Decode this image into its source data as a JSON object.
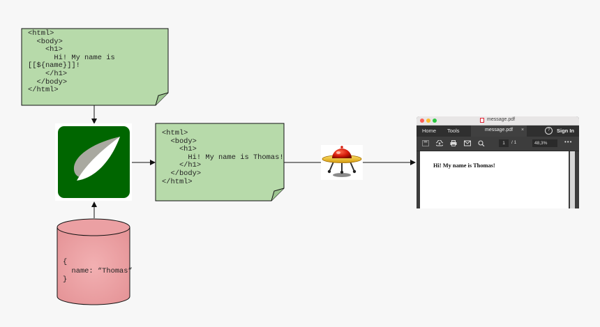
{
  "template": {
    "code": "<html>\n  <body>\n    <h1>\n      Hi! My name is\n[[${name}]]!\n    </h1>\n  </body>\n</html>"
  },
  "output": {
    "code": "<html>\n  <body>\n    <h1>\n      Hi! My name is Thomas!\n    </h1>\n  </body>\n</html>"
  },
  "datasource": {
    "code": "{\n  name: “Thomas”\n}"
  },
  "pdf_viewer": {
    "window_title": "message.pdf",
    "tabs": [
      "Home",
      "Tools"
    ],
    "doc_tab": "message.pdf",
    "close_glyph": "×",
    "help_glyph": "?",
    "sign_in": "Sign In",
    "page_current": "1",
    "page_total": "/ 1",
    "zoom": "48,3%",
    "more": "•••",
    "page_text": "Hi! My name is Thomas!"
  },
  "colors": {
    "note_fill": "#b7daaa",
    "db_fill": "#eba0a3",
    "engine_green": "#006600",
    "background": "#f7f7f7"
  }
}
